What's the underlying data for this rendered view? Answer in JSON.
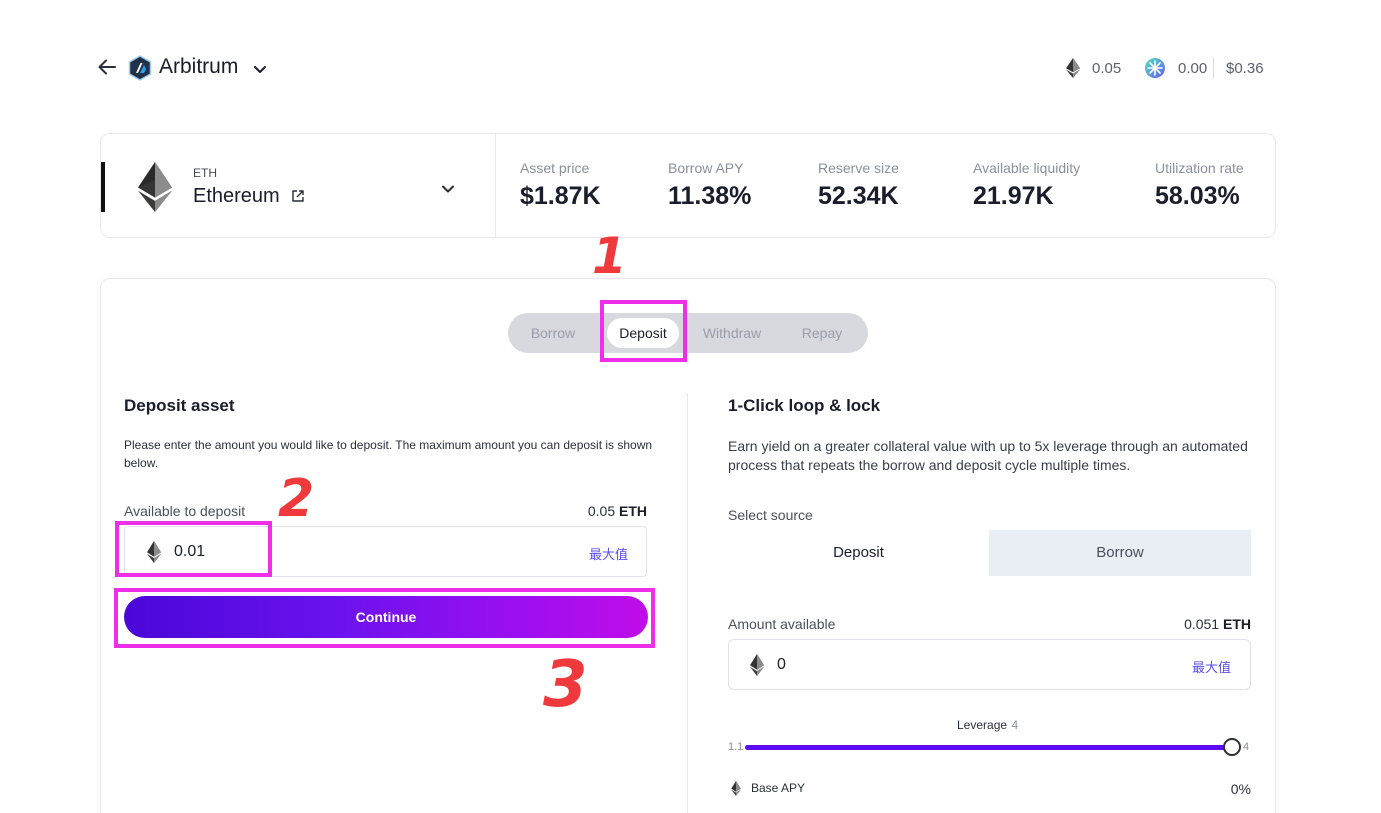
{
  "header": {
    "chain_name": "Arbitrum",
    "eth_balance": "0.05",
    "token_balance": "0.00",
    "usd_balance": "$0.36"
  },
  "asset": {
    "symbol": "ETH",
    "name": "Ethereum",
    "stats": [
      {
        "label": "Asset price",
        "value": "$1.87K"
      },
      {
        "label": "Borrow APY",
        "value": "11.38%"
      },
      {
        "label": "Reserve size",
        "value": "52.34K"
      },
      {
        "label": "Available liquidity",
        "value": "21.97K"
      },
      {
        "label": "Utilization rate",
        "value": "58.03%"
      }
    ]
  },
  "tabs": [
    {
      "label": "Borrow"
    },
    {
      "label": "Deposit"
    },
    {
      "label": "Withdraw"
    },
    {
      "label": "Repay"
    }
  ],
  "deposit": {
    "title": "Deposit asset",
    "description": "Please enter the amount you would like to deposit. The maximum amount you can deposit is shown below.",
    "available_label": "Available to deposit",
    "available_amount": "0.05",
    "available_unit": "ETH",
    "input_value": "0.01",
    "max_label": "最大值",
    "continue_label": "Continue"
  },
  "loop": {
    "title": "1-Click loop & lock",
    "description": "Earn yield on a greater collateral value with up to 5x leverage through an automated process that repeats the borrow and deposit cycle multiple times.",
    "select_source_label": "Select source",
    "source_options": [
      "Deposit",
      "Borrow"
    ],
    "amount_label": "Amount available",
    "amount_available": "0.051",
    "amount_unit": "ETH",
    "input_value": "0",
    "max_label": "最大值",
    "leverage_label": "Leverage",
    "leverage_value": "4",
    "leverage_min": "1.1",
    "leverage_max": "4",
    "base_apy_label": "Base APY",
    "base_apy_value": "0%"
  },
  "annotations": [
    "1",
    "2",
    "3"
  ],
  "colors": {
    "accent": "#5a0cf2",
    "highlight": "#ee2ee8",
    "annotation": "#f0393d"
  }
}
